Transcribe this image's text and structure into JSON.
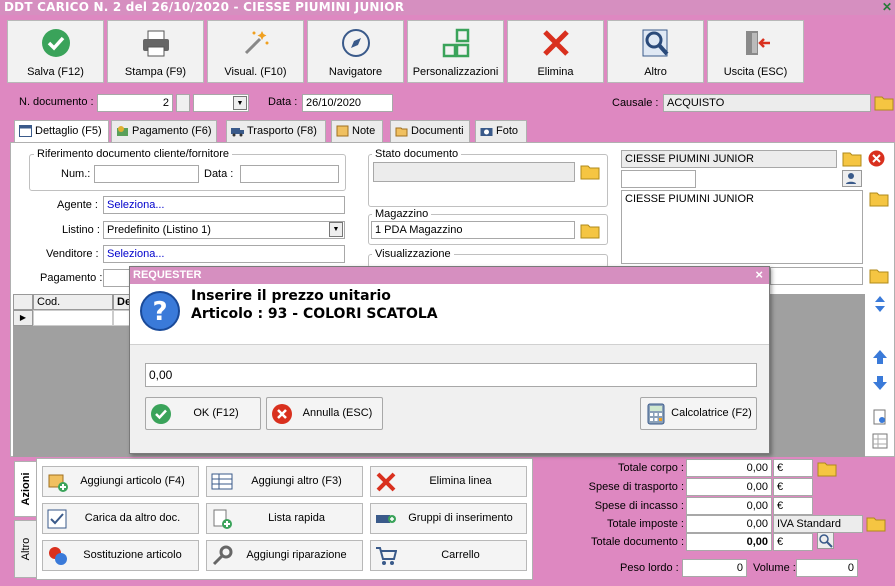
{
  "window": {
    "title": "DDT CARICO N. 2 del 26/10/2020 - CIESSE PIUMINI JUNIOR",
    "close_glyph": "✕"
  },
  "toolbar": {
    "buttons": [
      {
        "label": "Salva (F12)",
        "icon": "check-circle-icon"
      },
      {
        "label": "Stampa (F9)",
        "icon": "printer-icon"
      },
      {
        "label": "Visual. (F10)",
        "icon": "magic-wand-icon"
      },
      {
        "label": "Navigatore",
        "icon": "compass-icon"
      },
      {
        "label": "Personalizzazioni",
        "icon": "grid-icon"
      },
      {
        "label": "Elimina",
        "icon": "red-x-icon"
      },
      {
        "label": "Altro",
        "icon": "magnifier-icon"
      },
      {
        "label": "Uscita (ESC)",
        "icon": "exit-door-icon"
      }
    ]
  },
  "header": {
    "doc_number_label": "N. documento :",
    "doc_number": "2",
    "date_label": "Data :",
    "date": "26/10/2020",
    "causale_label": "Causale :",
    "causale": "ACQUISTO"
  },
  "tabs": [
    {
      "label": "Dettaglio (F5)",
      "active": true
    },
    {
      "label": "Pagamento (F6)"
    },
    {
      "label": "Trasporto (F8)"
    },
    {
      "label": "Note"
    },
    {
      "label": "Documenti"
    },
    {
      "label": "Foto"
    }
  ],
  "detail": {
    "ref_group_title": "Riferimento documento cliente/fornitore",
    "num_label": "Num.:",
    "num_value": "",
    "data_label": "Data :",
    "data_value": "",
    "agente_label": "Agente :",
    "agente_value": "Seleziona...",
    "listino_label": "Listino :",
    "listino_value": "Predefinito (Listino 1)",
    "venditore_label": "Venditore :",
    "venditore_value": "Seleziona...",
    "pagamento_label": "Pagamento :",
    "stato_title": "Stato documento",
    "magazzino_title": "Magazzino",
    "magazzino_value": "1 PDA Magazzino",
    "visualizzazione_title": "Visualizzazione",
    "cliente_name": "CIESSE PIUMINI JUNIOR",
    "cliente_address": "CIESSE PIUMINI JUNIOR"
  },
  "grid": {
    "columns": [
      "Cod.",
      "De"
    ]
  },
  "dialog": {
    "title": "REQUESTER",
    "close_glyph": "×",
    "message_line1": "Inserire il prezzo unitario",
    "message_line2": "Articolo : 93 - COLORI SCATOLA",
    "input_value": "0,00",
    "ok_label": "OK (F12)",
    "cancel_label": "Annulla (ESC)",
    "calc_label": "Calcolatrice (F2)"
  },
  "actions": {
    "vtab_azioni": "Azioni",
    "vtab_altro": "Altro",
    "buttons": [
      [
        "Aggiungi articolo (F4)",
        "Aggiungi altro (F3)",
        "Elimina linea"
      ],
      [
        "Carica da altro doc.",
        "Lista rapida",
        "Gruppi di inserimento"
      ],
      [
        "Sostituzione articolo",
        "Aggiungi riparazione",
        "Carrello"
      ]
    ]
  },
  "totals": {
    "corpo_label": "Totale corpo :",
    "corpo": "0,00",
    "corpo_cur": "€",
    "trasporto_label": "Spese di trasporto :",
    "trasporto": "0,00",
    "trasporto_cur": "€",
    "incasso_label": "Spese di incasso :",
    "incasso": "0,00",
    "incasso_cur": "€",
    "imposte_label": "Totale imposte :",
    "imposte": "0,00",
    "iva": "IVA Standard",
    "documento_label": "Totale documento :",
    "documento": "0,00",
    "documento_cur": "€",
    "peso_label": "Peso lordo :",
    "peso": "0",
    "volume_label": "Volume :",
    "volume": "0"
  },
  "colors": {
    "accent": "#de88c1",
    "title": "#d68fc0",
    "link": "#0000cc"
  }
}
